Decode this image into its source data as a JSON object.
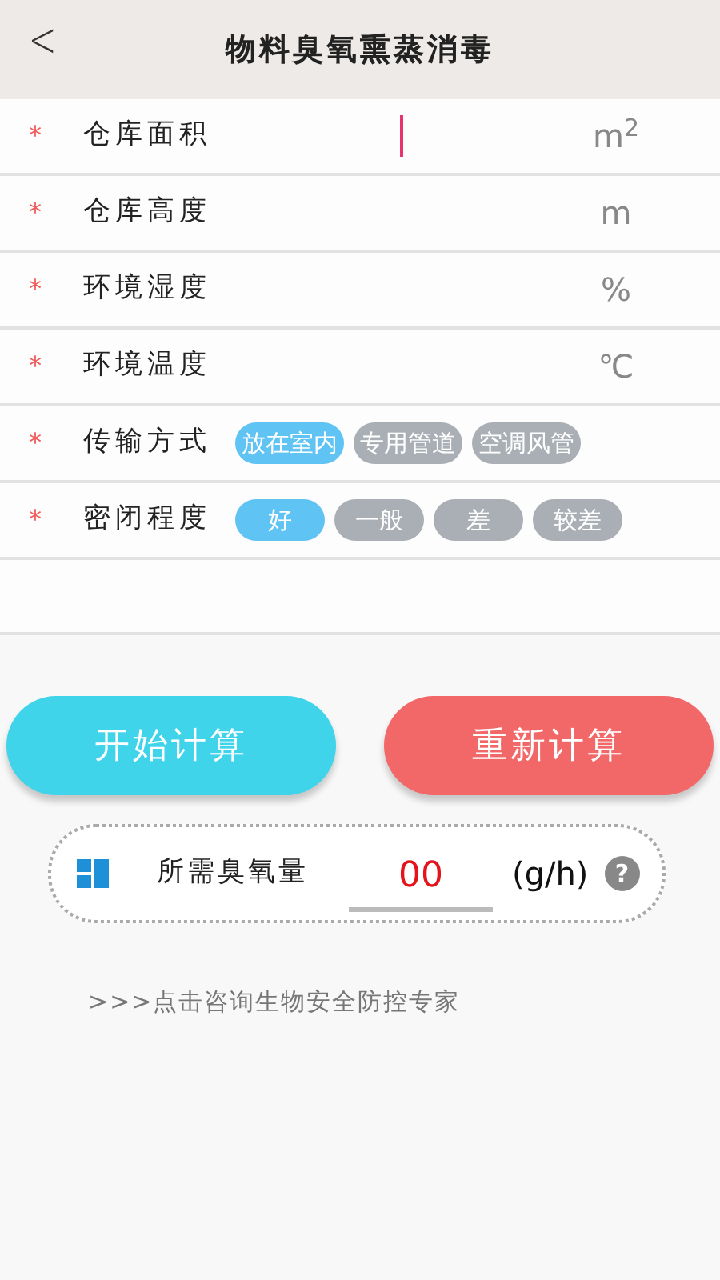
{
  "header": {
    "back": "<",
    "title": "物料臭氧熏蒸消毒"
  },
  "fields": [
    {
      "kind": "input",
      "required": "*",
      "label": "仓库面积",
      "unit": "m$^{2}$",
      "focused": true
    },
    {
      "kind": "input",
      "required": "*",
      "label": "仓库高度",
      "unit": "m",
      "focused": false
    },
    {
      "kind": "input",
      "required": "*",
      "label": "环境湿度",
      "unit": "%",
      "focused": false
    },
    {
      "kind": "input",
      "required": "*",
      "label": "环境温度",
      "unit": "℃",
      "focused": false
    },
    {
      "kind": "options",
      "required": "*",
      "label": "传输方式",
      "options": [
        {
          "label": "放在室内",
          "selected": true
        },
        {
          "label": "专用管道",
          "selected": false
        },
        {
          "label": "空调风管",
          "selected": false
        }
      ]
    },
    {
      "kind": "options",
      "required": "*",
      "label": "密闭程度",
      "options": [
        {
          "label": "好",
          "selected": true
        },
        {
          "label": "一般",
          "selected": false
        },
        {
          "label": "差",
          "selected": false
        },
        {
          "label": "较差",
          "selected": false
        }
      ]
    }
  ],
  "buttons": [
    {
      "kind": "start",
      "label": "开始计算"
    },
    {
      "kind": "reset",
      "label": "重新计算"
    }
  ],
  "result": {
    "label": "所需臭氧量",
    "value": "00",
    "unit": "(g/h)",
    "help": "?"
  },
  "link": ">>>点击咨询生物安全防控专家"
}
